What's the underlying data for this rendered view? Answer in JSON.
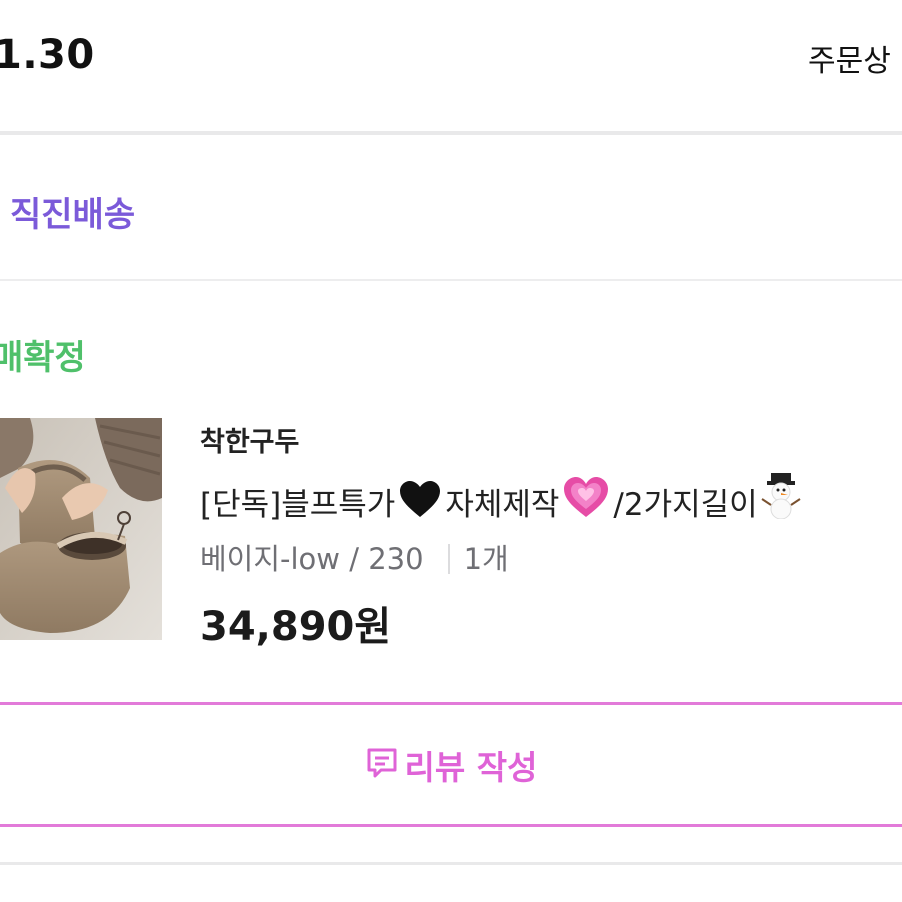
{
  "header": {
    "order_date": "1.30",
    "order_detail_link": "주문상"
  },
  "delivery": {
    "label": "직진배송",
    "color": "#7b5ad9"
  },
  "status": {
    "label": "매확정",
    "color": "#4fc06a"
  },
  "item": {
    "brand": "착한구두",
    "name_part1": "[단독]블프특가",
    "name_part2": "자체제작",
    "name_part3": "/2가지길이",
    "emojis": [
      "black-heart-icon",
      "growing-heart-icon",
      "snowman-icon"
    ],
    "options": "베이지-low / 230",
    "quantity": "1개",
    "price": "34,890원",
    "image": "beige-low-boots-photo"
  },
  "review": {
    "label": "리뷰 작성",
    "icon": "review-speech-bubble-icon",
    "color": "#df63d7"
  }
}
